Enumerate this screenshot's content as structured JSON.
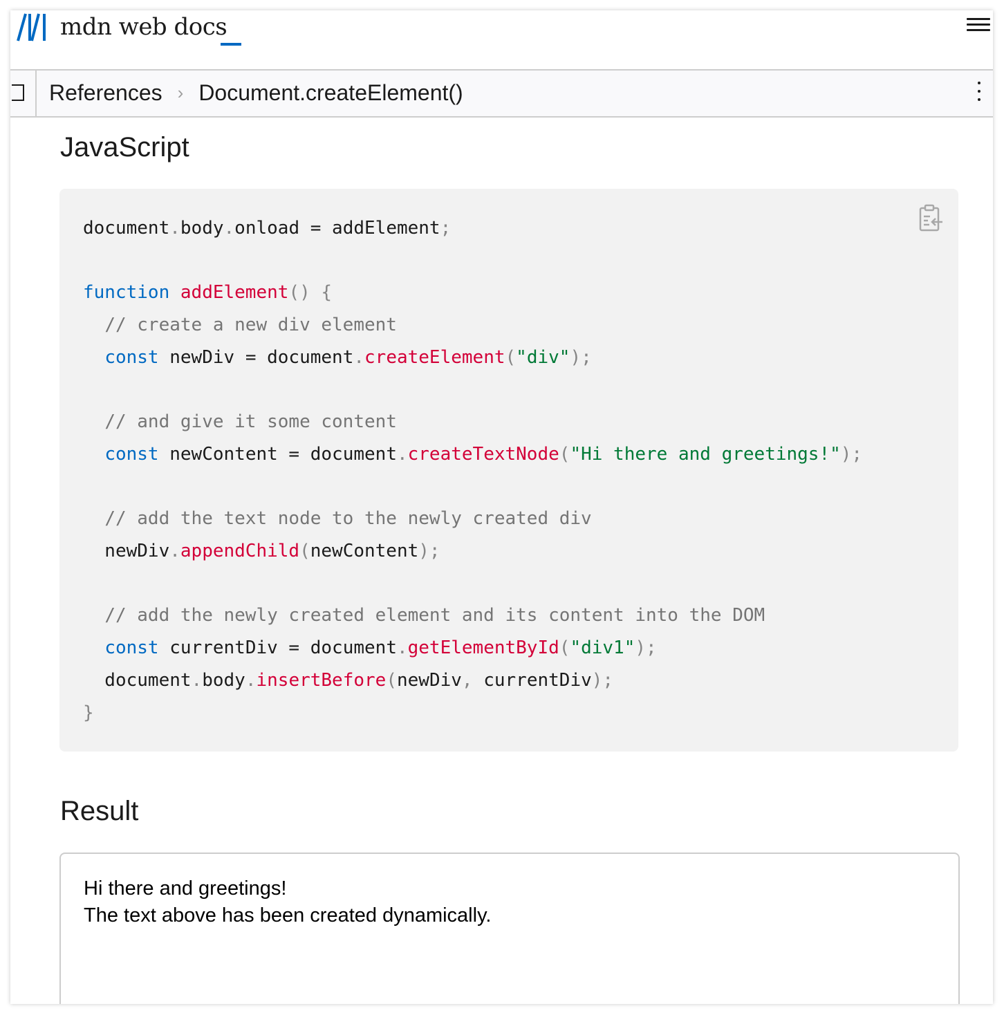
{
  "header": {
    "logo_text": "mdn web docs",
    "menu_icon": "hamburger-icon"
  },
  "breadcrumb": {
    "items": [
      "References",
      "Document.createElement()"
    ],
    "separator": "›",
    "sidebar_icon": "sidebar-toggle-icon",
    "more_icon": "kebab-menu-icon"
  },
  "sections": {
    "javascript_heading": "JavaScript",
    "result_heading": "Result"
  },
  "code": {
    "language": "JavaScript",
    "copy_icon": "clipboard-copy-icon",
    "lines": [
      [
        [
          "document",
          ""
        ],
        [
          ".",
          "pn"
        ],
        [
          "body",
          ""
        ],
        [
          ".",
          "pn"
        ],
        [
          "onload = addElement",
          ""
        ],
        [
          ";",
          "pn"
        ]
      ],
      [],
      [
        [
          "function",
          "kw"
        ],
        [
          " ",
          ""
        ],
        [
          "addElement",
          "fn"
        ],
        [
          "() {",
          "pn"
        ]
      ],
      [
        [
          "  ",
          ""
        ],
        [
          "// create a new div element",
          "cm"
        ]
      ],
      [
        [
          "  ",
          ""
        ],
        [
          "const",
          "kw"
        ],
        [
          " newDiv = document",
          ""
        ],
        [
          ".",
          "pn"
        ],
        [
          "createElement",
          "fn"
        ],
        [
          "(",
          "pn"
        ],
        [
          "\"div\"",
          "str"
        ],
        [
          ");",
          "pn"
        ]
      ],
      [],
      [
        [
          "  ",
          ""
        ],
        [
          "// and give it some content",
          "cm"
        ]
      ],
      [
        [
          "  ",
          ""
        ],
        [
          "const",
          "kw"
        ],
        [
          " newContent = document",
          ""
        ],
        [
          ".",
          "pn"
        ],
        [
          "createTextNode",
          "fn"
        ],
        [
          "(",
          "pn"
        ],
        [
          "\"Hi there and greetings!\"",
          "str"
        ],
        [
          ");",
          "pn"
        ]
      ],
      [],
      [
        [
          "  ",
          ""
        ],
        [
          "// add the text node to the newly created div",
          "cm"
        ]
      ],
      [
        [
          "  newDiv",
          ""
        ],
        [
          ".",
          "pn"
        ],
        [
          "appendChild",
          "fn"
        ],
        [
          "(",
          "pn"
        ],
        [
          "newContent",
          ""
        ],
        [
          ");",
          "pn"
        ]
      ],
      [],
      [
        [
          "  ",
          ""
        ],
        [
          "// add the newly created element and its content into the DOM",
          "cm"
        ]
      ],
      [
        [
          "  ",
          ""
        ],
        [
          "const",
          "kw"
        ],
        [
          " currentDiv = document",
          ""
        ],
        [
          ".",
          "pn"
        ],
        [
          "getElementById",
          "fn"
        ],
        [
          "(",
          "pn"
        ],
        [
          "\"div1\"",
          "str"
        ],
        [
          ");",
          "pn"
        ]
      ],
      [
        [
          "  document",
          ""
        ],
        [
          ".",
          "pn"
        ],
        [
          "body",
          ""
        ],
        [
          ".",
          "pn"
        ],
        [
          "insertBefore",
          "fn"
        ],
        [
          "(",
          "pn"
        ],
        [
          "newDiv",
          ""
        ],
        [
          ",",
          "pn"
        ],
        [
          " currentDiv",
          ""
        ],
        [
          ");",
          "pn"
        ]
      ],
      [
        [
          "}",
          "pn"
        ]
      ]
    ]
  },
  "result": {
    "lines": [
      "Hi there and greetings!",
      "The text above has been created dynamically."
    ]
  },
  "colors": {
    "accent": "#0069c2",
    "keyword": "#0069c2",
    "function": "#d30038",
    "string": "#007936",
    "comment": "#757575",
    "code_bg": "#f2f2f2"
  }
}
